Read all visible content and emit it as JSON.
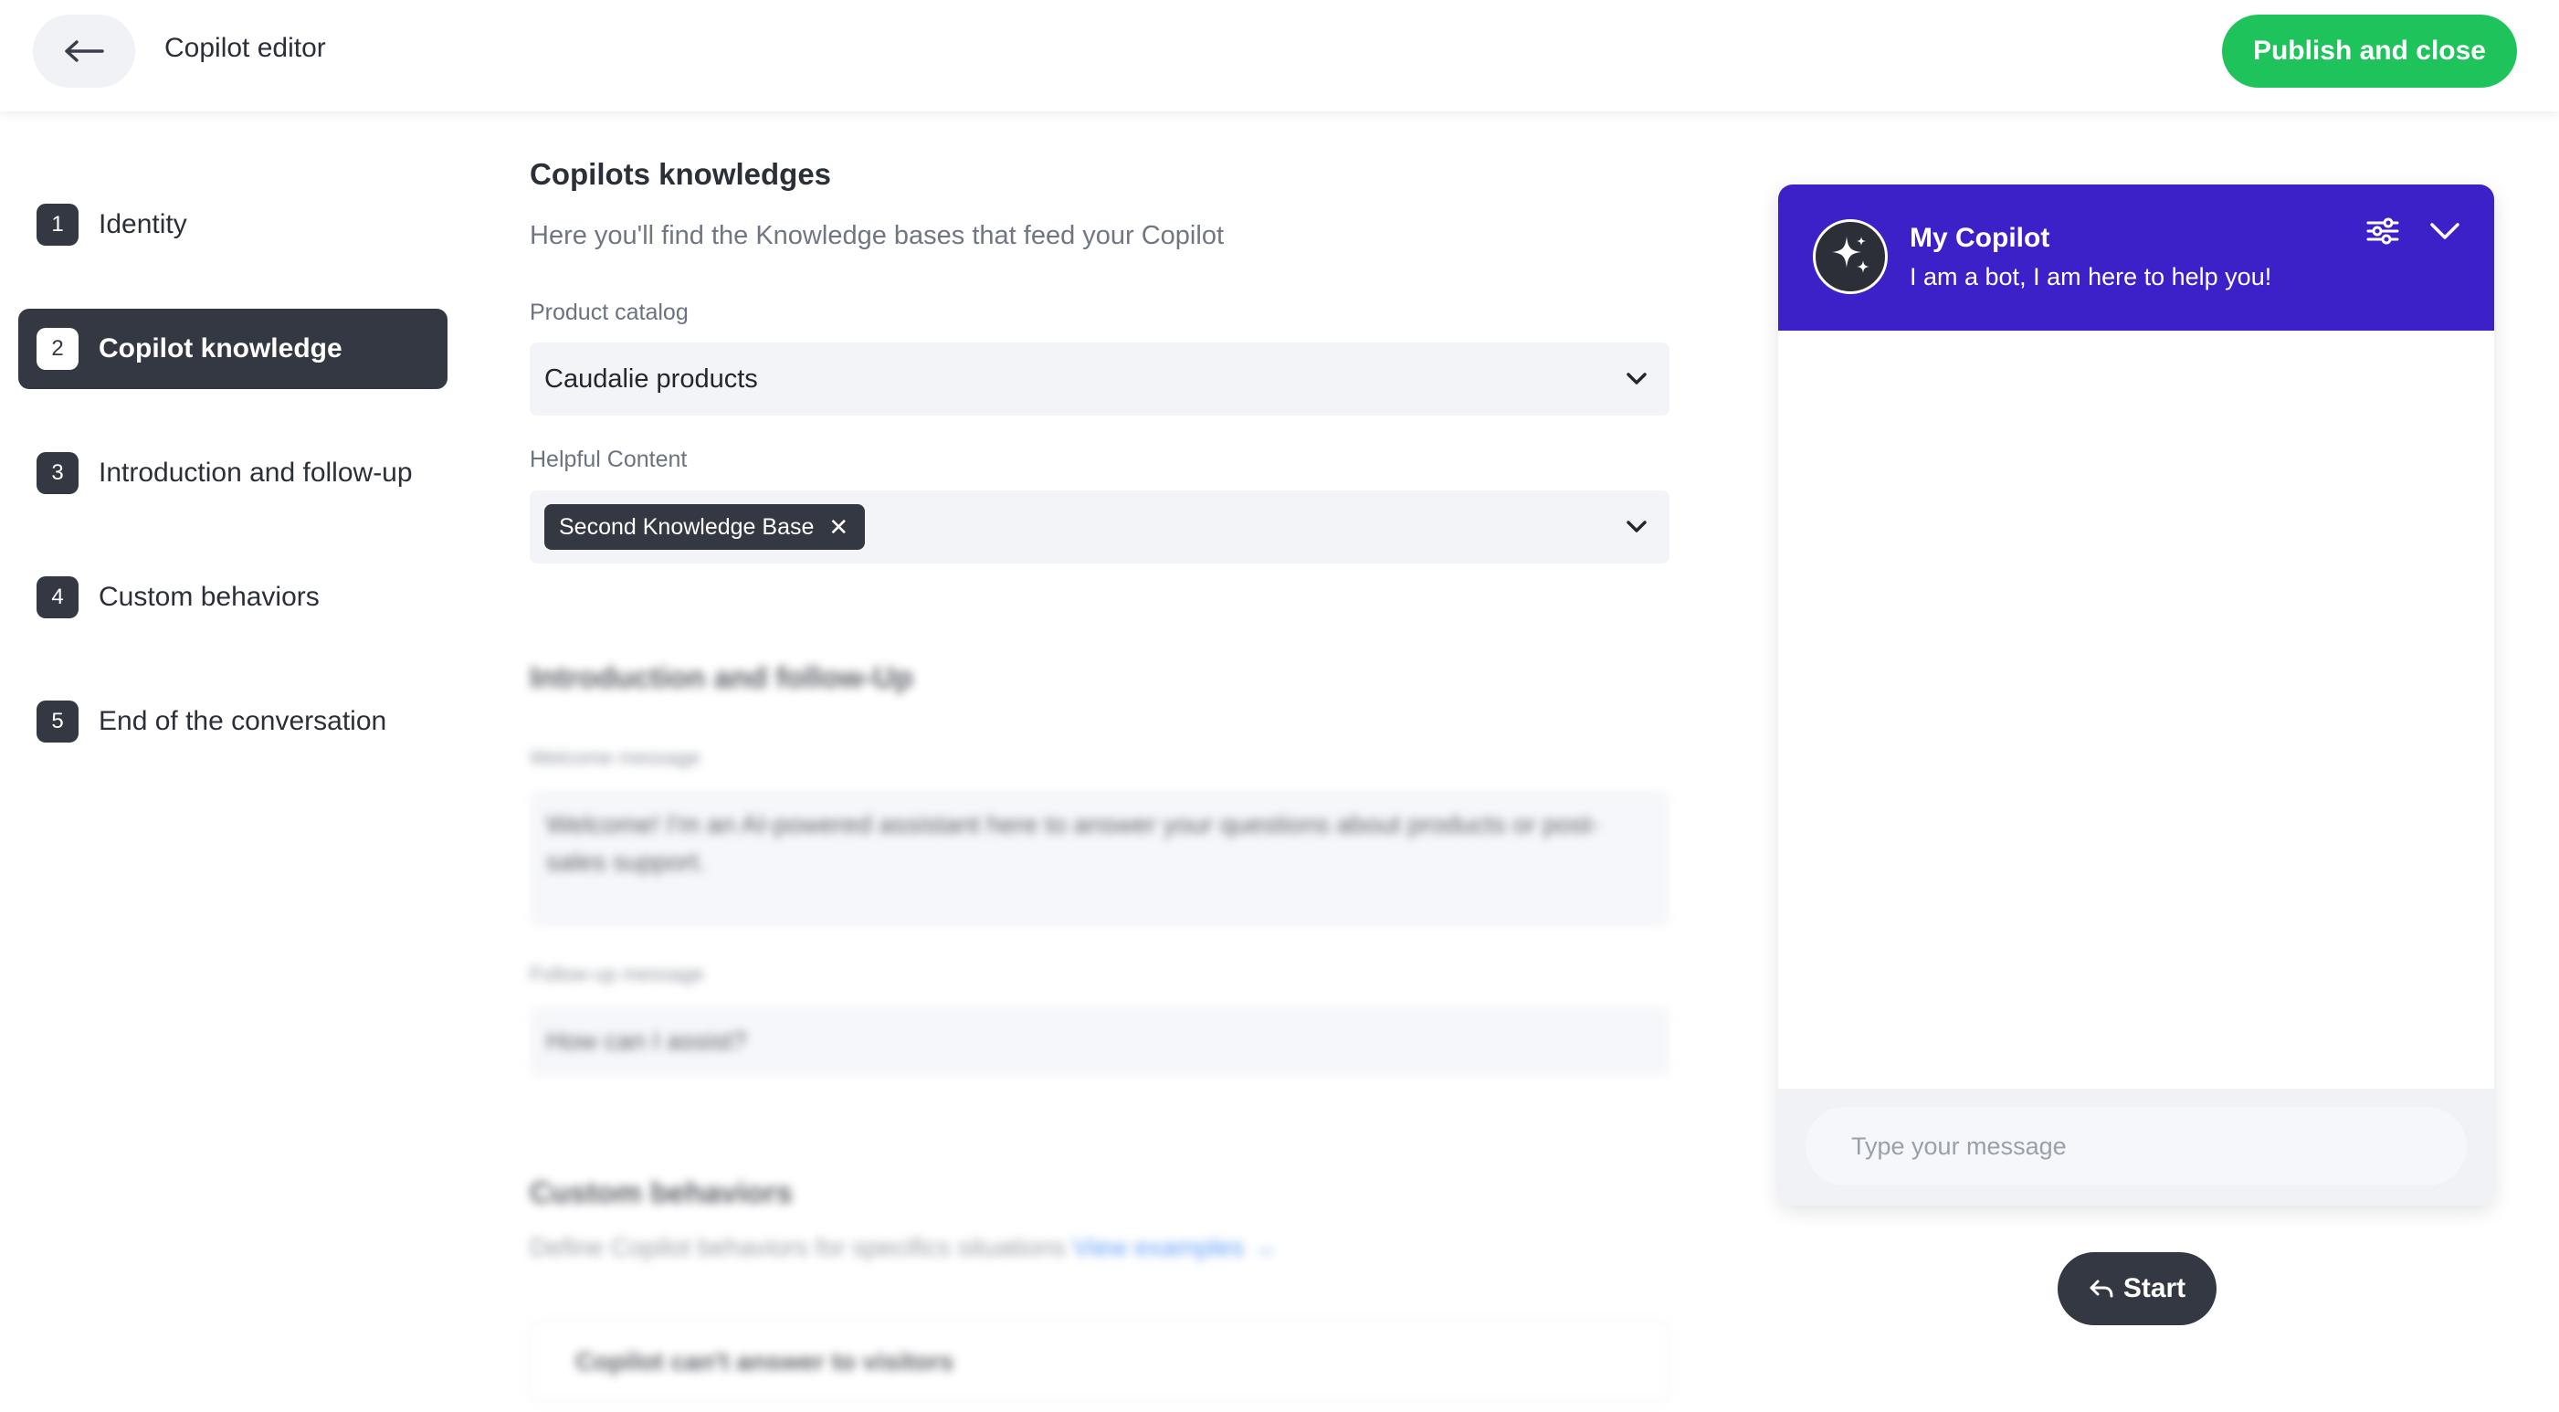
{
  "header": {
    "title": "Copilot editor",
    "publish_label": "Publish and close"
  },
  "steps": [
    {
      "number": "1",
      "label": "Identity",
      "active": false
    },
    {
      "number": "2",
      "label": "Copilot knowledge",
      "active": true
    },
    {
      "number": "3",
      "label": "Introduction and follow-up",
      "active": false
    },
    {
      "number": "4",
      "label": "Custom behaviors",
      "active": false
    },
    {
      "number": "5",
      "label": "End of the conversation",
      "active": false
    }
  ],
  "knowledge": {
    "title": "Copilots knowledges",
    "subtitle": "Here you'll find the Knowledge bases that feed your Copilot",
    "product_catalog_label": "Product catalog",
    "product_catalog_value": "Caudalie products",
    "helpful_content_label": "Helpful Content",
    "helpful_content_tags": [
      "Second Knowledge Base"
    ]
  },
  "intro": {
    "title": "Introduction and follow-Up",
    "welcome_label": "Welcome message",
    "welcome_value": "Welcome! I'm an AI-powered assistant here to answer your questions about products or post-sales support.",
    "followup_label": "Follow-up message",
    "followup_value": "How can I assist?"
  },
  "behaviors": {
    "title": "Custom behaviors",
    "subtitle": "Define Copilot behaviors for specifics situations",
    "link": "View examples →",
    "first_card": "Copilot can't answer to visitors"
  },
  "chat": {
    "name": "My Copilot",
    "tagline": "I am a bot, I am here to help you!",
    "input_placeholder": "Type your message",
    "start_label": "Start",
    "header_color": "#3c21c8"
  },
  "icons": {
    "back": "arrow-left-icon",
    "avatar": "sparkle-icon",
    "settings": "sliders-icon",
    "collapse": "chevron-down-icon",
    "start": "reply-arrow-icon",
    "tag_remove": "close-icon"
  },
  "colors": {
    "accent_green": "#1fc35c",
    "dark": "#343842"
  }
}
